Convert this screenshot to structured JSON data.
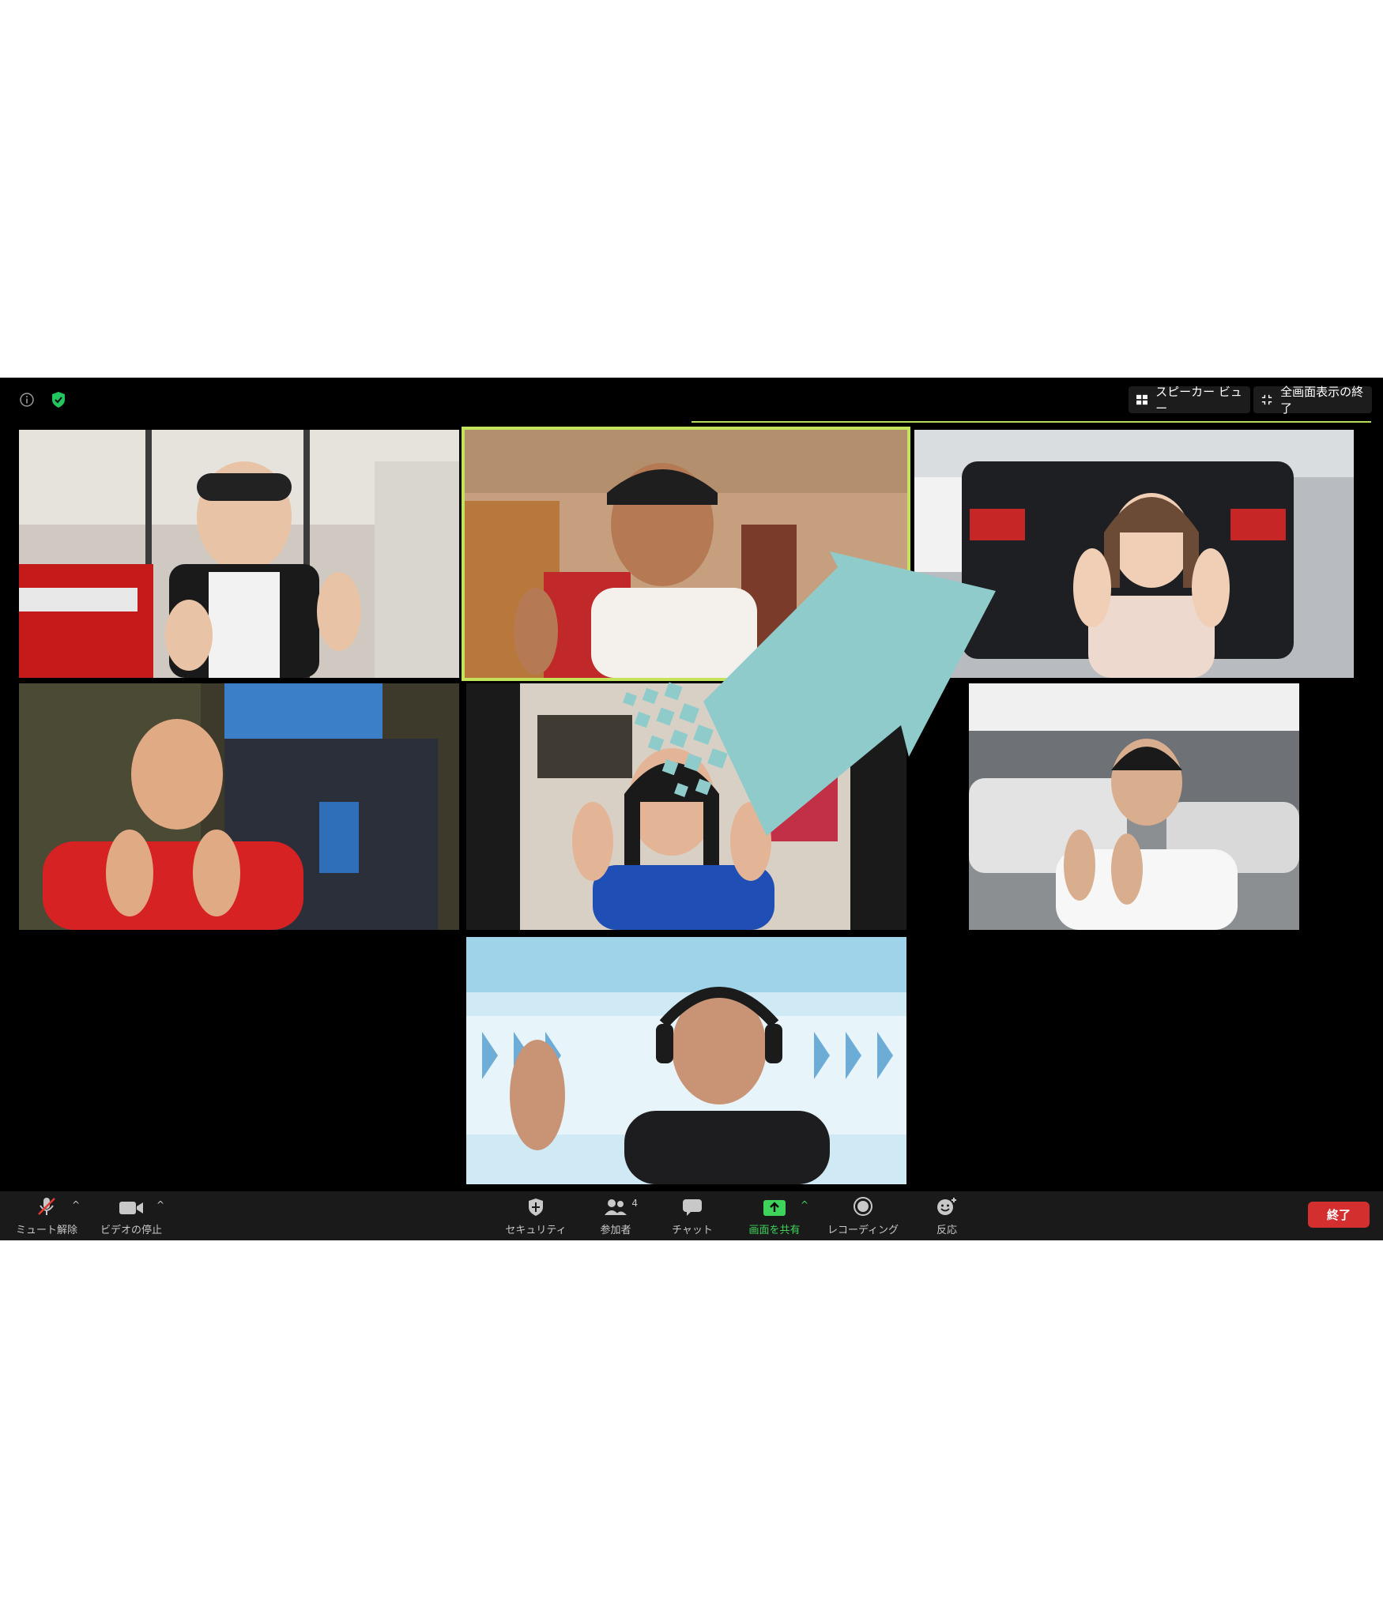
{
  "topbar": {
    "speaker_view_label": "スピーカー ビュー",
    "exit_fullscreen_label": "全画面表示の終了"
  },
  "participants_count": "4",
  "toolbar": {
    "mute_label": "ミュート解除",
    "video_label": "ビデオの停止",
    "security_label": "セキュリティ",
    "participants_label": "参加者",
    "chat_label": "チャット",
    "share_label": "画面を共有",
    "record_label": "レコーディング",
    "reactions_label": "反応",
    "end_label": "終了"
  },
  "colors": {
    "active_speaker_border": "#c4e35a",
    "share_green": "#3ed35a",
    "end_red": "#d32f2f",
    "arrow_teal": "#8fcbcb"
  }
}
